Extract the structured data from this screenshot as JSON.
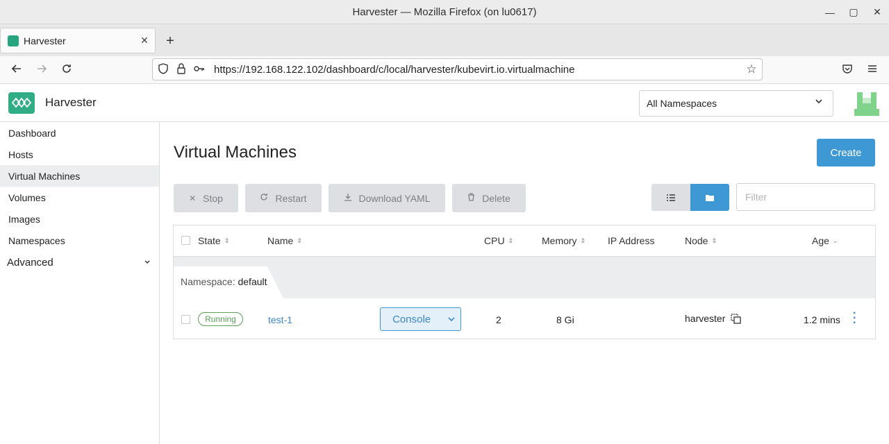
{
  "window": {
    "title": "Harvester — Mozilla Firefox (on lu0617)",
    "controls": {
      "minimize": "—",
      "maximize": "▢",
      "close": "✕"
    }
  },
  "browser": {
    "tab_label": "Harvester",
    "tab_close": "✕",
    "new_tab": "+",
    "url": "https://192.168.122.102/dashboard/c/local/harvester/kubevirt.io.virtualmachine",
    "icons": [
      "back-icon",
      "forward-icon",
      "reload-icon",
      "shield-icon",
      "lock-icon",
      "key-icon",
      "star-icon",
      "pocket-icon",
      "menu-icon"
    ]
  },
  "header": {
    "brand": "Harvester",
    "namespace_select": "All Namespaces",
    "brand_color": "#30ad85"
  },
  "sidebar": {
    "items": [
      {
        "label": "Dashboard"
      },
      {
        "label": "Hosts"
      },
      {
        "label": "Virtual Machines",
        "active": true
      },
      {
        "label": "Volumes"
      },
      {
        "label": "Images"
      },
      {
        "label": "Namespaces"
      }
    ],
    "advanced": "Advanced"
  },
  "main": {
    "title": "Virtual Machines",
    "create_label": "Create",
    "actions": {
      "stop": "Stop",
      "restart": "Restart",
      "download_yaml": "Download YAML",
      "delete": "Delete"
    },
    "filter_placeholder": "Filter",
    "accent_color": "#3d98d3"
  },
  "table": {
    "columns": {
      "state": "State",
      "name": "Name",
      "cpu": "CPU",
      "memory": "Memory",
      "ip": "IP Address",
      "node": "Node",
      "age": "Age"
    },
    "group": {
      "prefix": "Namespace:",
      "value": "default"
    },
    "rows": [
      {
        "state": "Running",
        "name": "test-1",
        "console": "Console",
        "cpu": "2",
        "memory": "8 Gi",
        "ip": "",
        "node": "harvester",
        "age": "1.2 mins"
      }
    ]
  }
}
